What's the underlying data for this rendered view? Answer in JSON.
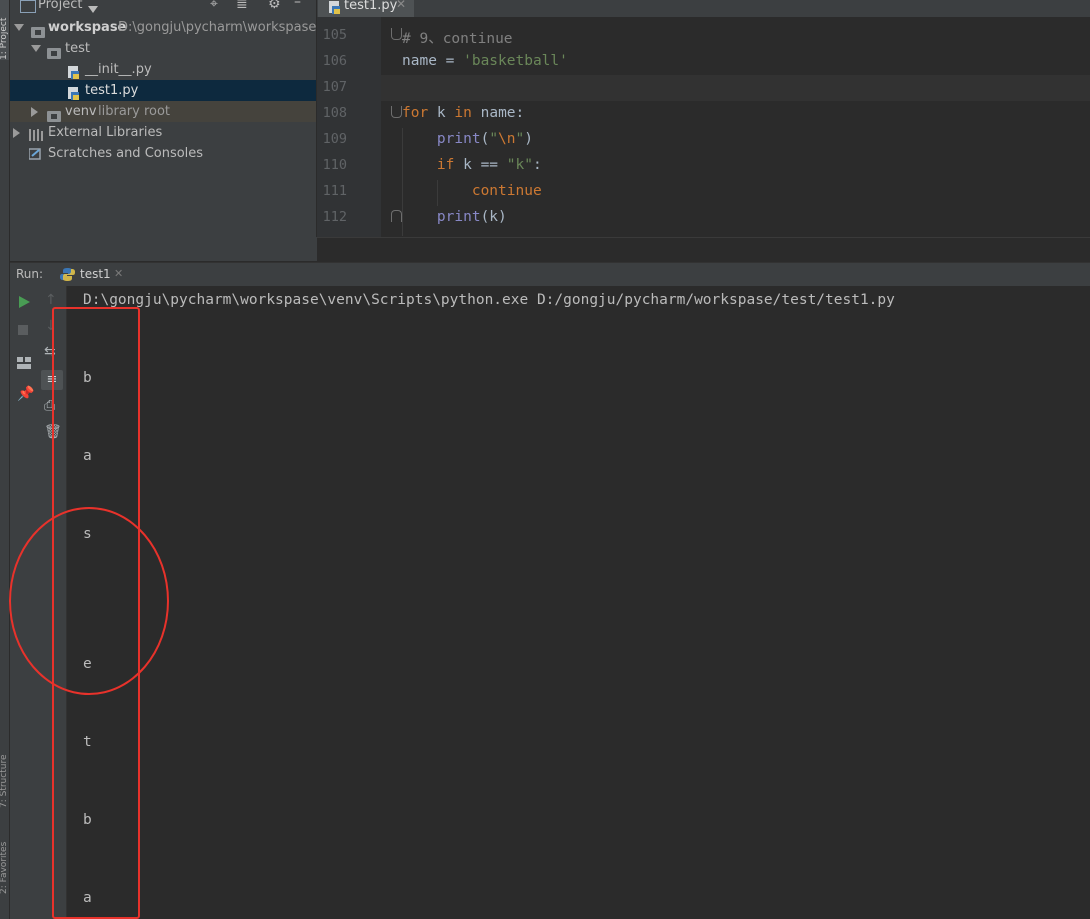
{
  "sidebar_labels": {
    "project": "1: Project",
    "structure": "7: Structure",
    "favorites": "2: Favorites"
  },
  "project_panel": {
    "title": "Project",
    "tree": [
      {
        "label": "workspase",
        "path": "D:\\gongju\\pycharm\\workspase"
      },
      {
        "label": "test"
      },
      {
        "label": "__init__.py"
      },
      {
        "label": "test1.py"
      },
      {
        "label": "venv",
        "suffix": "library root"
      },
      {
        "label": "External Libraries"
      },
      {
        "label": "Scratches and Consoles"
      }
    ]
  },
  "editor": {
    "tab": "test1.py",
    "lines": [
      {
        "number": "105",
        "text": "# 9、continue"
      },
      {
        "number": "106",
        "text": "name = 'basketball'"
      },
      {
        "number": "107",
        "text": ""
      },
      {
        "number": "108",
        "text": "for k in name:"
      },
      {
        "number": "109",
        "text": "    print(\"\\n\")"
      },
      {
        "number": "110",
        "text": "    if k == \"k\":"
      },
      {
        "number": "111",
        "text": "        continue"
      },
      {
        "number": "112",
        "text": "    print(k)"
      }
    ]
  },
  "run": {
    "label": "Run:",
    "tab": "test1",
    "command": "D:\\gongju\\pycharm\\workspase\\venv\\Scripts\\python.exe D:/gongju/pycharm/workspase/test/test1.py",
    "output": [
      "b",
      "a",
      "s",
      "e",
      "t",
      "b",
      "a"
    ]
  },
  "colors": {
    "annotation": "#e8322b",
    "keyword": "#cc7832",
    "string": "#6a8759",
    "comment": "#808080",
    "builtin": "#8888c6",
    "run_green": "#499c54"
  }
}
